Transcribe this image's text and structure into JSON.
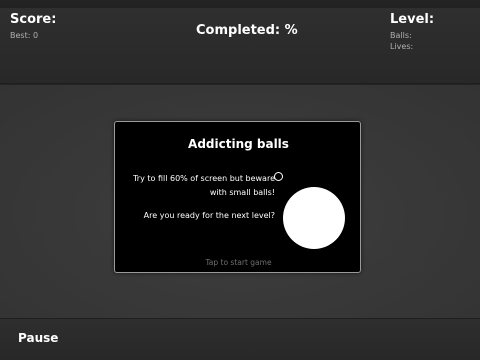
{
  "hud": {
    "score_label": "Score:",
    "best_label": "Best: 0",
    "completed_label": "Completed: %",
    "level_label": "Level:",
    "balls_label": "Balls:",
    "lives_label": "Lives:"
  },
  "dialog": {
    "title": "Addicting balls",
    "instruction_line1": "Try to fill 60% of screen but beware",
    "instruction_line2": "with small balls!",
    "question": "Are you ready for the next level?",
    "tap_to_start": "Tap to start game"
  },
  "footer": {
    "pause_label": "Pause"
  },
  "colors": {
    "background": "#333333",
    "dialog_background": "#000000",
    "text": "#ffffff",
    "muted_text": "#b0b0b0",
    "hint_text": "#6f6f6f"
  }
}
